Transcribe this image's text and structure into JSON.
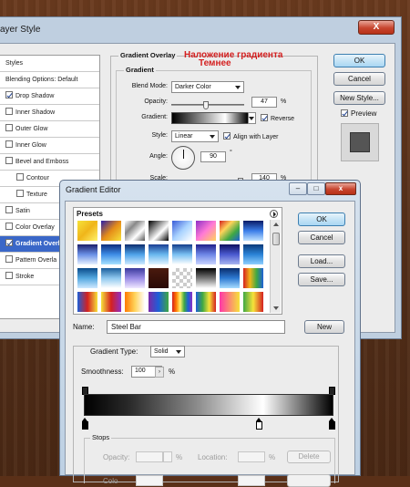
{
  "layer_style": {
    "title": "ayer Style",
    "close": "X",
    "styles_header": "Styles",
    "items": [
      {
        "label": "Blending Options: Default",
        "checkbox": false,
        "checked": false,
        "sub": false,
        "selected": false
      },
      {
        "label": "Drop Shadow",
        "checkbox": true,
        "checked": true,
        "sub": false,
        "selected": false
      },
      {
        "label": "Inner Shadow",
        "checkbox": true,
        "checked": false,
        "sub": false,
        "selected": false
      },
      {
        "label": "Outer Glow",
        "checkbox": true,
        "checked": false,
        "sub": false,
        "selected": false
      },
      {
        "label": "Inner Glow",
        "checkbox": true,
        "checked": false,
        "sub": false,
        "selected": false
      },
      {
        "label": "Bevel and Emboss",
        "checkbox": true,
        "checked": false,
        "sub": false,
        "selected": false
      },
      {
        "label": "Contour",
        "checkbox": true,
        "checked": false,
        "sub": true,
        "selected": false
      },
      {
        "label": "Texture",
        "checkbox": true,
        "checked": false,
        "sub": true,
        "selected": false
      },
      {
        "label": "Satin",
        "checkbox": true,
        "checked": false,
        "sub": false,
        "selected": false
      },
      {
        "label": "Color Overlay",
        "checkbox": true,
        "checked": false,
        "sub": false,
        "selected": false
      },
      {
        "label": "Gradient Overl",
        "checkbox": true,
        "checked": true,
        "sub": false,
        "selected": true
      },
      {
        "label": "Pattern Overla",
        "checkbox": true,
        "checked": false,
        "sub": false,
        "selected": false
      },
      {
        "label": "Stroke",
        "checkbox": true,
        "checked": false,
        "sub": false,
        "selected": false
      }
    ],
    "group_title": "Gradient Overlay",
    "subgroup_title": "Gradient",
    "annotation_title": "Наложение градиента",
    "annotation_blend": "Темнее",
    "blend_mode_label": "Blend Mode:",
    "blend_mode_value": "Darker Color",
    "opacity_label": "Opacity:",
    "opacity_value": "47",
    "opacity_unit": "%",
    "opacity_fraction": 0.47,
    "gradient_label": "Gradient:",
    "reverse_label": "Reverse",
    "style_label": "Style:",
    "style_value": "Linear",
    "align_label": "Align with Layer",
    "angle_label": "Angle:",
    "angle_value": "90",
    "angle_unit": "°",
    "scale_label": "Scale:",
    "scale_value": "140",
    "scale_unit": "%",
    "buttons": {
      "ok": "OK",
      "cancel": "Cancel",
      "new_style": "New Style...",
      "preview": "Preview"
    }
  },
  "gradient_editor": {
    "title": "Gradient Editor",
    "presets_label": "Presets",
    "buttons": {
      "ok": "OK",
      "cancel": "Cancel",
      "load": "Load...",
      "save": "Save...",
      "new": "New"
    },
    "name_label": "Name:",
    "name_value": "Steel Bar",
    "gradient_type_label": "Gradient Type:",
    "gradient_type_value": "Solid",
    "smoothness_label": "Smoothness:",
    "smoothness_value": "100",
    "smoothness_unit": "%",
    "stops_label": "Stops",
    "stop_opacity_label": "Opacity:",
    "stop_location_label": "Location:",
    "percent": "%",
    "delete_label": "Delete",
    "color_label": "Colo"
  }
}
